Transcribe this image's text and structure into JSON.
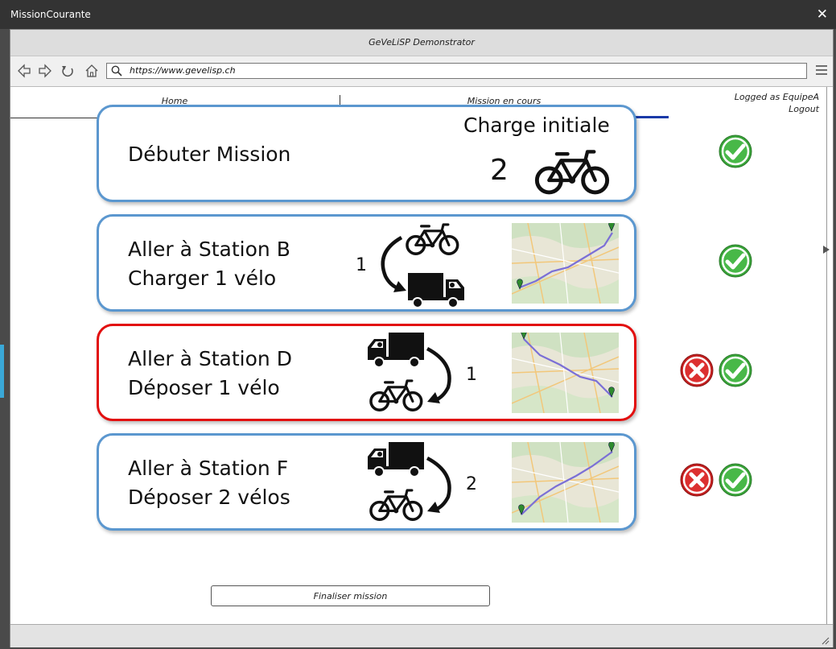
{
  "window": {
    "title": "MissionCourante",
    "close_glyph": "✕"
  },
  "app": {
    "title": "GeVeLiSP Demonstrator"
  },
  "browser": {
    "url": "https://www.gevelisp.ch"
  },
  "tabs": [
    {
      "label": "Home",
      "active": false
    },
    {
      "label": "Mission en cours",
      "active": true
    }
  ],
  "user": {
    "logged_as": "Logged as EquipeA",
    "logout_label": "Logout"
  },
  "cards": [
    {
      "title": "Débuter Mission",
      "line2": "",
      "charge_label": "Charge initiale",
      "count": "2",
      "type": "start",
      "active": false,
      "status": [
        "ok"
      ]
    },
    {
      "title": "Aller à Station B",
      "line2": "Charger 1 vélo",
      "count": "1",
      "type": "load",
      "active": false,
      "status": [
        "ok"
      ]
    },
    {
      "title": "Aller à Station D",
      "line2": "Déposer 1 vélo",
      "count": "1",
      "type": "unload",
      "active": true,
      "status": [
        "cancel",
        "ok"
      ]
    },
    {
      "title": "Aller à Station F",
      "line2": "Déposer 2 vélos",
      "count": "2",
      "type": "unload",
      "active": false,
      "status": [
        "cancel",
        "ok"
      ]
    }
  ],
  "finalize_label": "Finaliser mission",
  "colors": {
    "active_border": "#e20f0f",
    "card_border": "#5b97cf",
    "ok": "#3aa53a",
    "cancel": "#d42a2a",
    "tab_underline": "#1a3aa8"
  },
  "icons": [
    "back-icon",
    "forward-icon",
    "reload-icon",
    "home-icon",
    "search-icon",
    "menu-icon",
    "bicycle-icon",
    "truck-icon",
    "curved-arrow-icon",
    "check-icon",
    "cancel-icon"
  ]
}
